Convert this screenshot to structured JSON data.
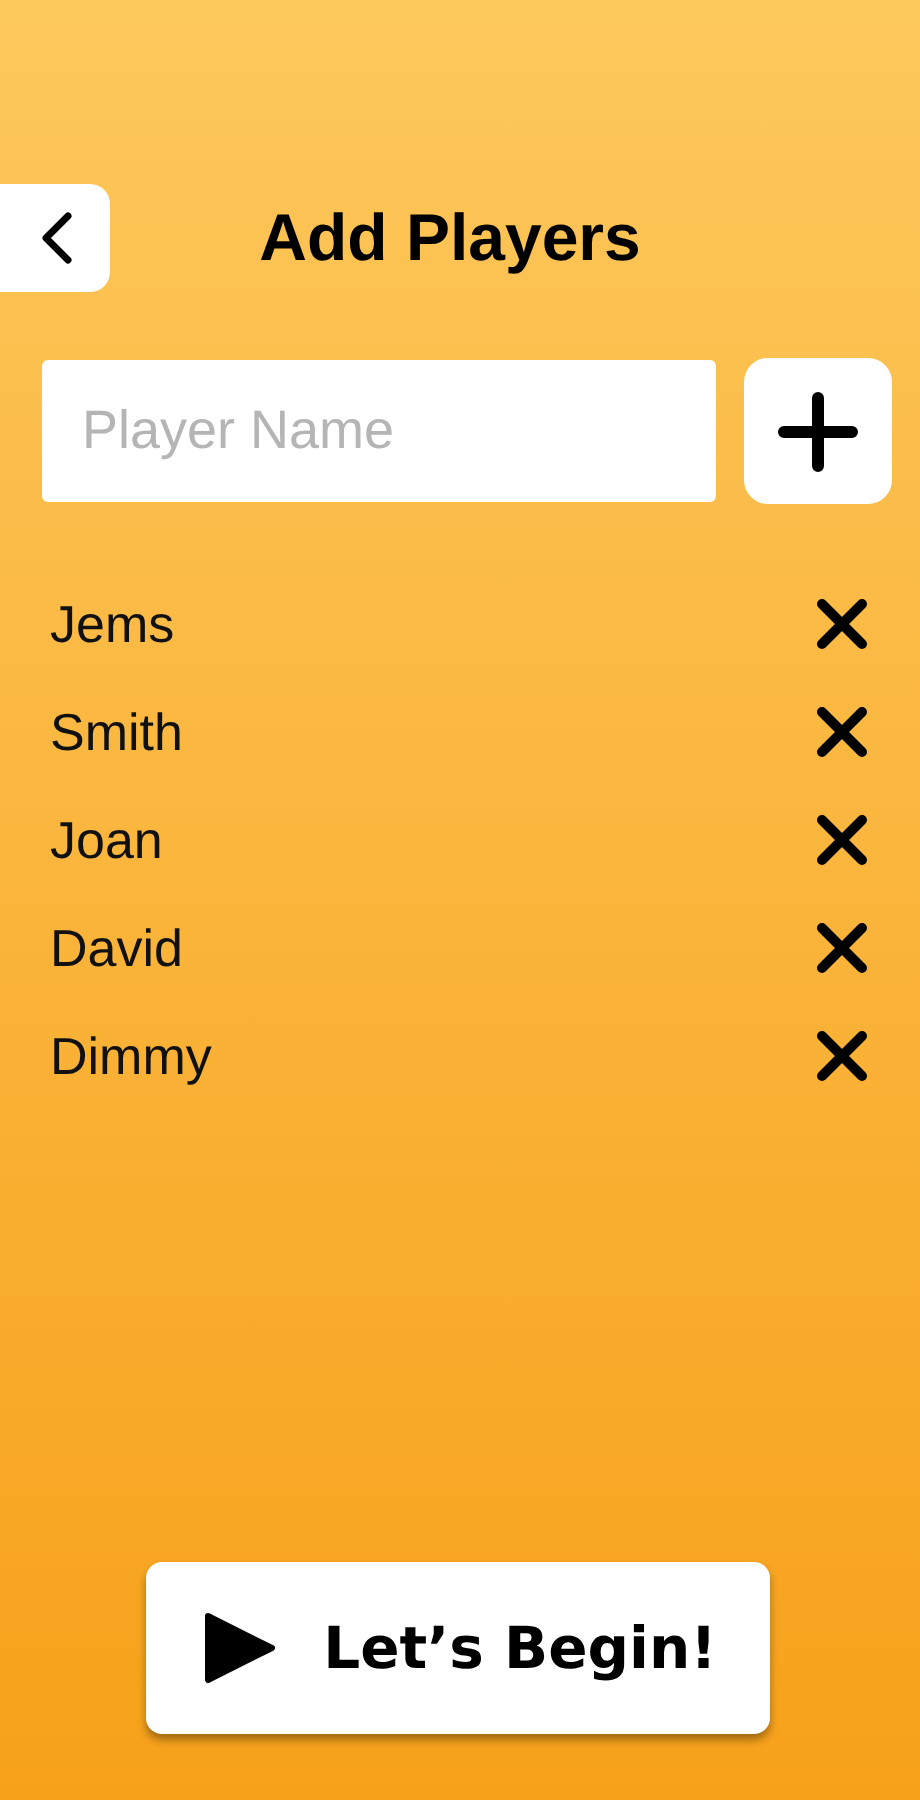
{
  "header": {
    "title": "Add Players"
  },
  "input": {
    "placeholder": "Player Name"
  },
  "players": [
    {
      "name": "Jems"
    },
    {
      "name": "Smith"
    },
    {
      "name": "Joan"
    },
    {
      "name": "David"
    },
    {
      "name": "Dimmy"
    }
  ],
  "start_button": {
    "label": "Let’s Begin!"
  }
}
